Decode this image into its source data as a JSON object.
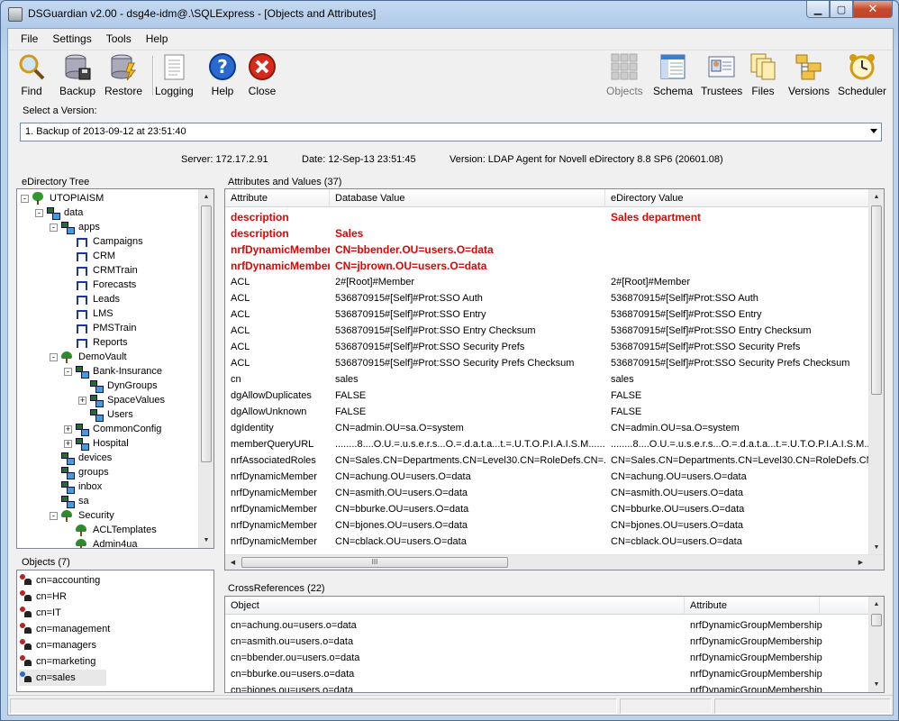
{
  "window": {
    "title": "DSGuardian v2.00 - dsg4e-idm@.\\SQLExpress - [Objects and Attributes]",
    "min": "▁",
    "max": "▢",
    "close": "✕"
  },
  "menu": [
    "File",
    "Settings",
    "Tools",
    "Help"
  ],
  "toolbar": {
    "left": [
      {
        "label": "Find",
        "icon": "magnifier-icon"
      },
      {
        "label": "Backup",
        "icon": "database-backup-icon"
      },
      {
        "label": "Restore",
        "icon": "database-restore-icon"
      },
      {
        "label": "Logging",
        "icon": "log-document-icon"
      },
      {
        "label": "Help",
        "icon": "help-icon"
      },
      {
        "label": "Close",
        "icon": "close-icon"
      }
    ],
    "right": [
      {
        "label": "Objects",
        "icon": "objects-grid-icon",
        "disabled": true
      },
      {
        "label": "Schema",
        "icon": "schema-window-icon"
      },
      {
        "label": "Trustees",
        "icon": "trustees-card-icon"
      },
      {
        "label": "Files",
        "icon": "files-icon"
      },
      {
        "label": "Versions",
        "icon": "versions-folders-icon"
      },
      {
        "label": "Scheduler",
        "icon": "alarm-clock-icon"
      }
    ]
  },
  "version": {
    "label": "Select a Version:",
    "selected": "1. Backup of 2013-09-12 at 23:51:40"
  },
  "info": {
    "server": "Server: 172.17.2.91",
    "date": "Date: 12-Sep-13 23:51:45",
    "agent": "Version: LDAP Agent for Novell eDirectory 8.8 SP6 (20601.08)"
  },
  "tree": {
    "header": "eDirectory Tree",
    "nodes": [
      {
        "label": "UTOPIAISM",
        "level": 0,
        "icon": "tree",
        "exp": "-"
      },
      {
        "label": "data",
        "level": 1,
        "icon": "ou",
        "exp": "-"
      },
      {
        "label": "apps",
        "level": 2,
        "icon": "ou",
        "exp": "-"
      },
      {
        "label": "Campaigns",
        "level": 3,
        "icon": "grp",
        "exp": ""
      },
      {
        "label": "CRM",
        "level": 3,
        "icon": "grp",
        "exp": ""
      },
      {
        "label": "CRMTrain",
        "level": 3,
        "icon": "grp",
        "exp": ""
      },
      {
        "label": "Forecasts",
        "level": 3,
        "icon": "grp",
        "exp": ""
      },
      {
        "label": "Leads",
        "level": 3,
        "icon": "grp",
        "exp": ""
      },
      {
        "label": "LMS",
        "level": 3,
        "icon": "grp",
        "exp": ""
      },
      {
        "label": "PMSTrain",
        "level": 3,
        "icon": "grp",
        "exp": ""
      },
      {
        "label": "Reports",
        "level": 3,
        "icon": "grp",
        "exp": ""
      },
      {
        "label": "DemoVault",
        "level": 2,
        "icon": "org",
        "exp": "-"
      },
      {
        "label": "Bank-Insurance",
        "level": 3,
        "icon": "ou",
        "exp": "-"
      },
      {
        "label": "DynGroups",
        "level": 4,
        "icon": "ou",
        "exp": ""
      },
      {
        "label": "SpaceValues",
        "level": 4,
        "icon": "ou",
        "exp": "+"
      },
      {
        "label": "Users",
        "level": 4,
        "icon": "ou",
        "exp": ""
      },
      {
        "label": "CommonConfig",
        "level": 3,
        "icon": "ou",
        "exp": "+"
      },
      {
        "label": "Hospital",
        "level": 3,
        "icon": "ou",
        "exp": "+"
      },
      {
        "label": "devices",
        "level": 2,
        "icon": "ou",
        "exp": ""
      },
      {
        "label": "groups",
        "level": 2,
        "icon": "ou",
        "exp": ""
      },
      {
        "label": "inbox",
        "level": 2,
        "icon": "ou",
        "exp": ""
      },
      {
        "label": "sa",
        "level": 2,
        "icon": "ou",
        "exp": ""
      },
      {
        "label": "Security",
        "level": 2,
        "icon": "org",
        "exp": "-"
      },
      {
        "label": "ACLTemplates",
        "level": 3,
        "icon": "org",
        "exp": ""
      },
      {
        "label": "Admin4ua",
        "level": 3,
        "icon": "org",
        "exp": ""
      }
    ]
  },
  "objects": {
    "header": "Objects (7)",
    "items": [
      "cn=accounting",
      "cn=HR",
      "cn=IT",
      "cn=management",
      "cn=managers",
      "cn=marketing",
      "cn=sales"
    ],
    "selected": "cn=sales"
  },
  "attributes": {
    "header": "Attributes and Values (37)",
    "columns": [
      "Attribute",
      "Database Value",
      "eDirectory Value"
    ],
    "rows": [
      {
        "a": "description",
        "db": "",
        "ed": "Sales department",
        "diff": true
      },
      {
        "a": "description",
        "db": "Sales",
        "ed": "",
        "diff": true
      },
      {
        "a": "nrfDynamicMember",
        "db": "CN=bbender.OU=users.O=data",
        "ed": "",
        "diff": true
      },
      {
        "a": "nrfDynamicMember",
        "db": "CN=jbrown.OU=users.O=data",
        "ed": "",
        "diff": true
      },
      {
        "a": "ACL",
        "db": "2#[Root]#Member",
        "ed": "2#[Root]#Member"
      },
      {
        "a": "ACL",
        "db": "536870915#[Self]#Prot:SSO Auth",
        "ed": "536870915#[Self]#Prot:SSO Auth"
      },
      {
        "a": "ACL",
        "db": "536870915#[Self]#Prot:SSO Entry",
        "ed": "536870915#[Self]#Prot:SSO Entry"
      },
      {
        "a": "ACL",
        "db": "536870915#[Self]#Prot:SSO Entry Checksum",
        "ed": "536870915#[Self]#Prot:SSO Entry Checksum"
      },
      {
        "a": "ACL",
        "db": "536870915#[Self]#Prot:SSO Security Prefs",
        "ed": "536870915#[Self]#Prot:SSO Security Prefs"
      },
      {
        "a": "ACL",
        "db": "536870915#[Self]#Prot:SSO Security Prefs Checksum",
        "ed": "536870915#[Self]#Prot:SSO Security Prefs Checksum"
      },
      {
        "a": "cn",
        "db": "sales",
        "ed": "sales"
      },
      {
        "a": "dgAllowDuplicates",
        "db": "FALSE",
        "ed": "FALSE"
      },
      {
        "a": "dgAllowUnknown",
        "db": "FALSE",
        "ed": "FALSE"
      },
      {
        "a": "dgIdentity",
        "db": "CN=admin.OU=sa.O=system",
        "ed": "CN=admin.OU=sa.O=system"
      },
      {
        "a": "memberQueryURL",
        "db": "........8....O.U.=.u.s.e.r.s...O.=.d.a.t.a...t.=.U.T.O.P.I.A.I.S.M.........",
        "ed": "........8....O.U.=.u.s.e.r.s...O.=.d.a.t.a...t.=.U.T.O.P.I.A.I.S.M......"
      },
      {
        "a": "nrfAssociatedRoles",
        "db": "CN=Sales.CN=Departments.CN=Level30.CN=RoleDefs.CN=...",
        "ed": "CN=Sales.CN=Departments.CN=Level30.CN=RoleDefs.CN="
      },
      {
        "a": "nrfDynamicMember",
        "db": "CN=achung.OU=users.O=data",
        "ed": "CN=achung.OU=users.O=data"
      },
      {
        "a": "nrfDynamicMember",
        "db": "CN=asmith.OU=users.O=data",
        "ed": "CN=asmith.OU=users.O=data"
      },
      {
        "a": "nrfDynamicMember",
        "db": "CN=bburke.OU=users.O=data",
        "ed": "CN=bburke.OU=users.O=data"
      },
      {
        "a": "nrfDynamicMember",
        "db": "CN=bjones.OU=users.O=data",
        "ed": "CN=bjones.OU=users.O=data"
      },
      {
        "a": "nrfDynamicMember",
        "db": "CN=cblack.OU=users.O=data",
        "ed": "CN=cblack.OU=users.O=data"
      }
    ],
    "hscroll_mark": "III"
  },
  "crossrefs": {
    "header": "CrossReferences (22)",
    "columns": [
      "Object",
      "Attribute"
    ],
    "rows": [
      {
        "o": "cn=achung.ou=users.o=data",
        "a": "nrfDynamicGroupMembership"
      },
      {
        "o": "cn=asmith.ou=users.o=data",
        "a": "nrfDynamicGroupMembership"
      },
      {
        "o": "cn=bbender.ou=users.o=data",
        "a": "nrfDynamicGroupMembership"
      },
      {
        "o": "cn=bburke.ou=users.o=data",
        "a": "nrfDynamicGroupMembership"
      },
      {
        "o": "cn=bjones.ou=users.o=data",
        "a": "nrfDynamicGroupMembership"
      }
    ]
  }
}
